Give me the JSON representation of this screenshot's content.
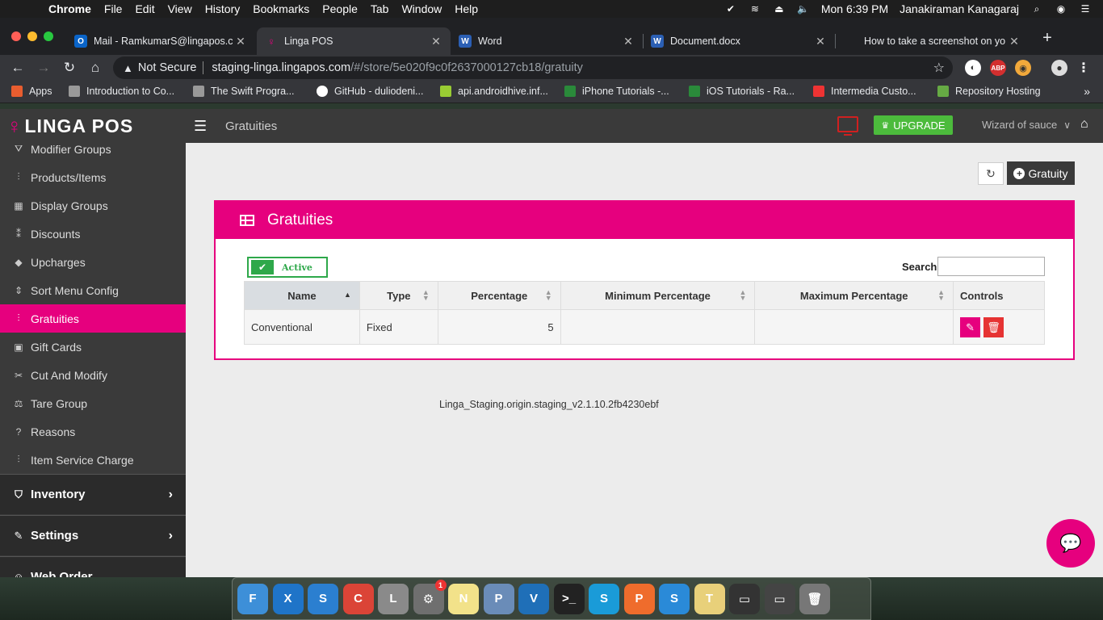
{
  "menubar": {
    "app_name": "Chrome",
    "items": [
      "File",
      "Edit",
      "View",
      "History",
      "Bookmarks",
      "People",
      "Tab",
      "Window",
      "Help"
    ],
    "clock": "Mon 6:39 PM",
    "user": "Janakiraman Kanagaraj"
  },
  "tabs": [
    {
      "title": "Mail - RamkumarS@lingapos.co",
      "favicon": "O",
      "color": "#0a64c8"
    },
    {
      "title": "Linga POS",
      "favicon": "L",
      "color": "#e6007e"
    },
    {
      "title": "Word",
      "favicon": "W",
      "color": "#2b5fb4"
    },
    {
      "title": "Document.docx",
      "favicon": "W",
      "color": "#2b5fb4"
    },
    {
      "title": "How to take a screenshot on yo",
      "favicon": "",
      "color": "#777"
    }
  ],
  "address": {
    "security": "Not Secure",
    "host": "staging-linga.lingapos.com",
    "path": "/#/store/5e020f9c0f2637000127cb18/gratuity"
  },
  "extensions": [
    "ABP"
  ],
  "bookmarks": [
    {
      "label": "Apps",
      "color": "#e85d2f"
    },
    {
      "label": "Introduction to Co...",
      "color": "#999"
    },
    {
      "label": "The Swift Progra...",
      "color": "#999"
    },
    {
      "label": "GitHub - duliodeni...",
      "color": "#fff"
    },
    {
      "label": "api.androidhive.inf...",
      "color": "#9c3"
    },
    {
      "label": "iPhone Tutorials -...",
      "color": "#2a8a3a"
    },
    {
      "label": "iOS Tutorials - Ra...",
      "color": "#2a8a3a"
    },
    {
      "label": "Intermedia Custo...",
      "color": "#e33"
    },
    {
      "label": "Repository Hosting",
      "color": "#6a4"
    }
  ],
  "app": {
    "logo_text": "LINGA POS",
    "page_title": "Gratuities",
    "upgrade_label": "UPGRADE",
    "store_name": "Wizard of sauce",
    "sidebar": [
      {
        "label": "Modifier Groups",
        "icon": "⛛",
        "active": false
      },
      {
        "label": "Products/Items",
        "icon": "⫶",
        "active": false
      },
      {
        "label": "Display Groups",
        "icon": "▦",
        "active": false
      },
      {
        "label": "Discounts",
        "icon": "⁑",
        "active": false
      },
      {
        "label": "Upcharges",
        "icon": "◆",
        "active": false
      },
      {
        "label": "Sort Menu Config",
        "icon": "⇕",
        "active": false
      },
      {
        "label": "Gratuities",
        "icon": "⫶",
        "active": true
      },
      {
        "label": "Gift Cards",
        "icon": "▣",
        "active": false
      },
      {
        "label": "Cut And Modify",
        "icon": "✂",
        "active": false
      },
      {
        "label": "Tare Group",
        "icon": "⚖",
        "active": false
      },
      {
        "label": "Reasons",
        "icon": "?",
        "active": false
      },
      {
        "label": "Item Service Charge",
        "icon": "⫶",
        "active": false
      }
    ],
    "groups": [
      {
        "label": "Inventory",
        "icon": "⛉"
      },
      {
        "label": "Settings",
        "icon": "✎"
      },
      {
        "label": "Web Order",
        "icon": "☺"
      }
    ],
    "add_button_label": "Gratuity",
    "panel_title": "Gratuities",
    "active_toggle_label": "Active",
    "search_label": "Search",
    "search_value": "",
    "table": {
      "columns": [
        "Name",
        "Type",
        "Percentage",
        "Minimum Percentage",
        "Maximum Percentage",
        "Controls"
      ],
      "rows": [
        {
          "name": "Conventional",
          "type": "Fixed",
          "percentage": "5",
          "min": "",
          "max": ""
        }
      ]
    },
    "version": "Linga_Staging.origin.staging_v2.1.10.2fb4230ebf"
  },
  "dock": [
    {
      "name": "finder-icon",
      "label": "F",
      "color": "#3d8fd8"
    },
    {
      "name": "xcode-icon",
      "label": "X",
      "color": "#1f74c8"
    },
    {
      "name": "simulator-icon",
      "label": "S",
      "color": "#2b7fd0"
    },
    {
      "name": "chrome-icon",
      "label": "C",
      "color": "#db4437"
    },
    {
      "name": "launchpad-icon",
      "label": "L",
      "color": "#8a8a8a"
    },
    {
      "name": "system-preferences-icon",
      "label": "⚙",
      "color": "#6f6f6f",
      "badge": "1"
    },
    {
      "name": "notes-icon",
      "label": "N",
      "color": "#f2e28a"
    },
    {
      "name": "preview-icon",
      "label": "P",
      "color": "#6a8cb8"
    },
    {
      "name": "vscode-icon",
      "label": "V",
      "color": "#1f6fb8"
    },
    {
      "name": "terminal-icon",
      "label": ">_",
      "color": "#222"
    },
    {
      "name": "skype-icon",
      "label": "S",
      "color": "#1a9bd8"
    },
    {
      "name": "postman-icon",
      "label": "P",
      "color": "#ef6c2c"
    },
    {
      "name": "safari-icon",
      "label": "S",
      "color": "#2a8ad8"
    },
    {
      "name": "textedit-icon",
      "label": "T",
      "color": "#e8d07a"
    },
    {
      "name": "screenshot-icon",
      "label": "▭",
      "color": "#333"
    },
    {
      "name": "window-icon",
      "label": "▭",
      "color": "#444"
    },
    {
      "name": "trash-icon",
      "label": "🗑",
      "color": "#777"
    }
  ]
}
